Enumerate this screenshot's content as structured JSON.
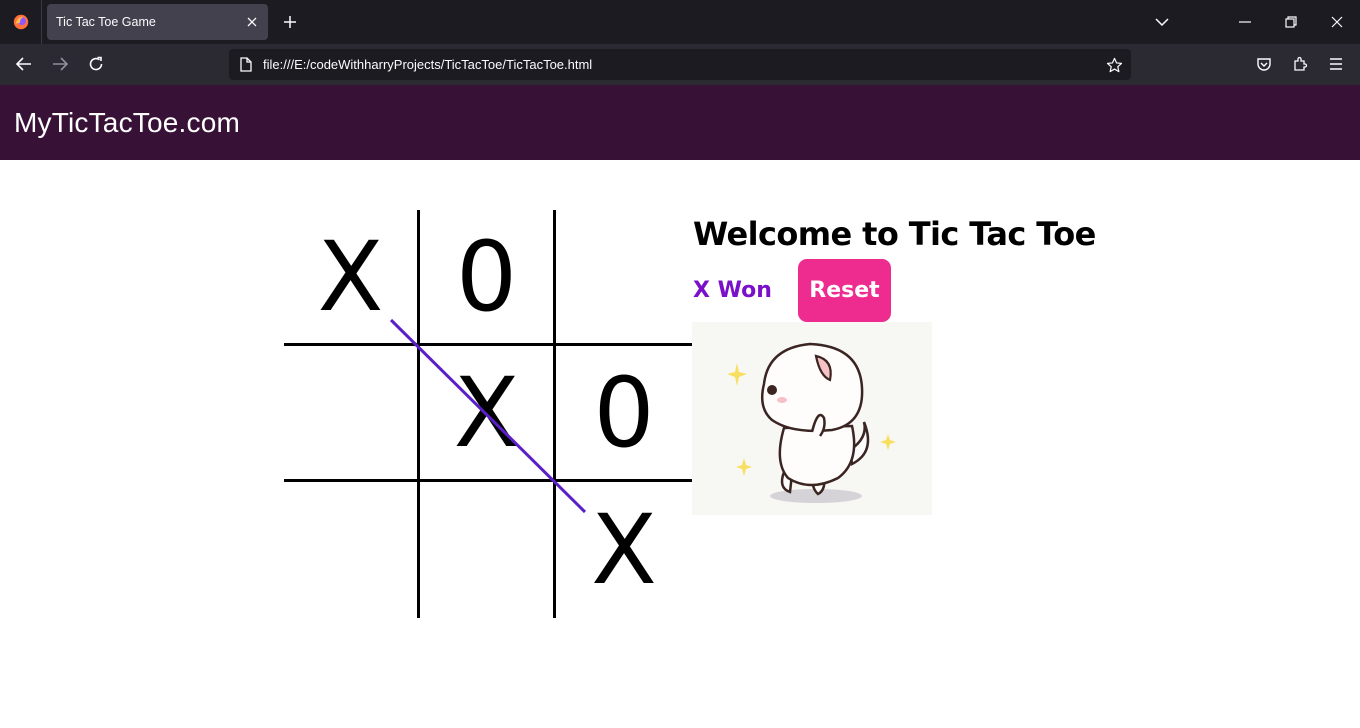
{
  "browser": {
    "tab_title": "Tic Tac Toe Game",
    "url": "file:///E:/codeWithharryProjects/TicTacToe/TicTacToe.html"
  },
  "site": {
    "brand": "MyTicTacToe.com"
  },
  "game": {
    "board": [
      "X",
      "0",
      "",
      "",
      "X",
      "0",
      "",
      "",
      "X"
    ],
    "heading": "Welcome to Tic Tac Toe",
    "status": "X Won",
    "reset_label": "Reset"
  },
  "colors": {
    "nav_bg": "#381236",
    "status_text": "#7a10c9",
    "reset_bg": "#ee2b8f",
    "win_line": "#5b1fc7"
  }
}
